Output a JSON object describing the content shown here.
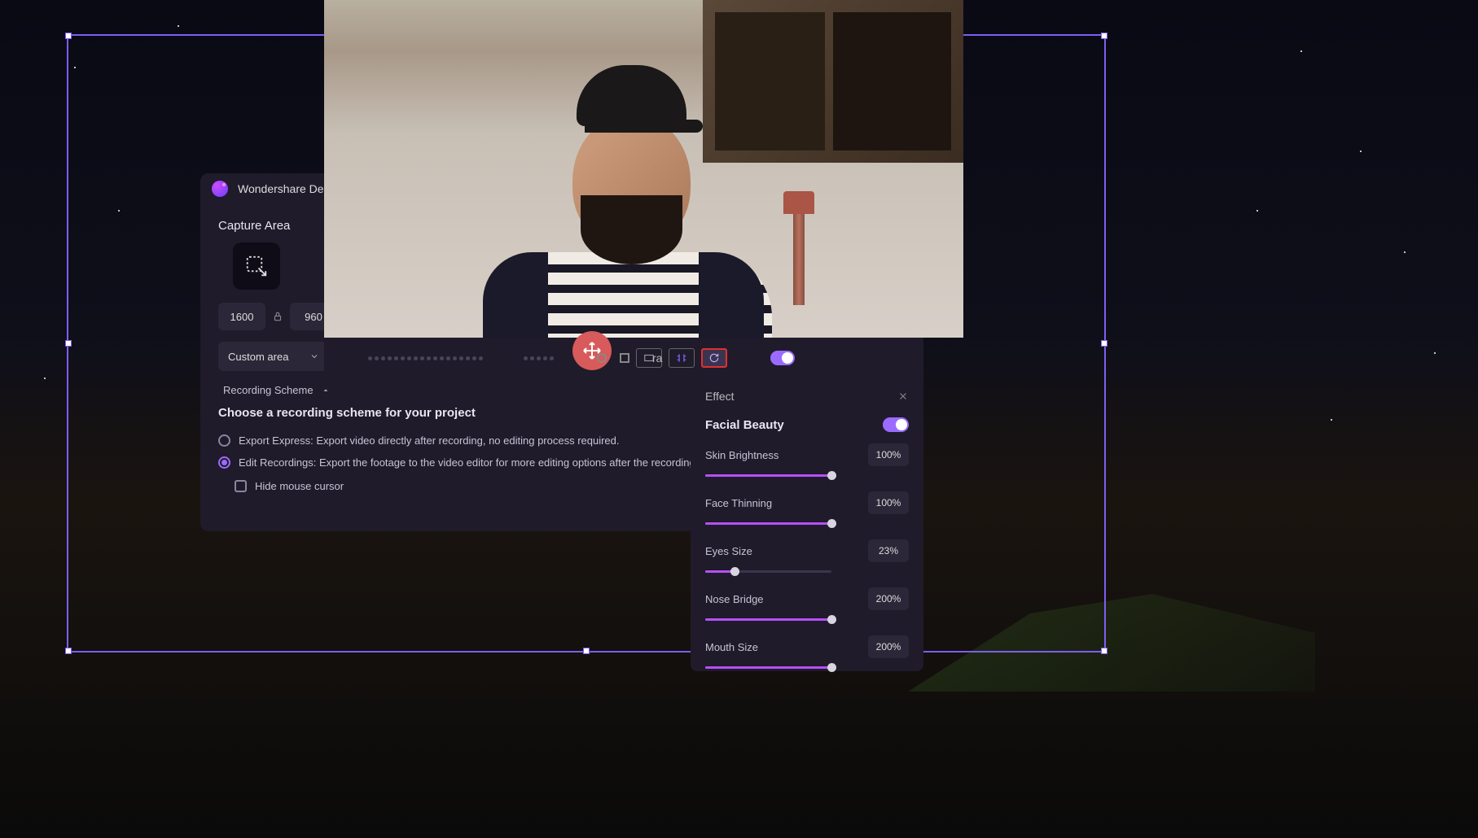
{
  "app": {
    "title": "Wondershare De"
  },
  "capture": {
    "section_label": "Capture Area",
    "width": "1600",
    "height": "960",
    "mode": "Custom area"
  },
  "scheme": {
    "header": "Recording Scheme",
    "title": "Choose a recording scheme for your project",
    "options": [
      {
        "label": "Export Express: Export video directly after recording, no editing process required.",
        "checked": false
      },
      {
        "label": "Edit Recordings: Export the footage to the video editor for more editing options after the recording is dor",
        "checked": true
      }
    ],
    "hide_cursor": "Hide mouse cursor"
  },
  "toolbar": {
    "preview_label": " ra"
  },
  "effect": {
    "title": "Effect",
    "facial_beauty": "Facial Beauty",
    "sliders": [
      {
        "label": "Skin Brightness",
        "value": "100%",
        "pct": 100
      },
      {
        "label": "Face Thinning",
        "value": "100%",
        "pct": 100
      },
      {
        "label": "Eyes Size",
        "value": "23%",
        "pct": 23
      },
      {
        "label": "Nose Bridge",
        "value": "200%",
        "pct": 100
      },
      {
        "label": "Mouth Size",
        "value": "200%",
        "pct": 100
      }
    ]
  }
}
